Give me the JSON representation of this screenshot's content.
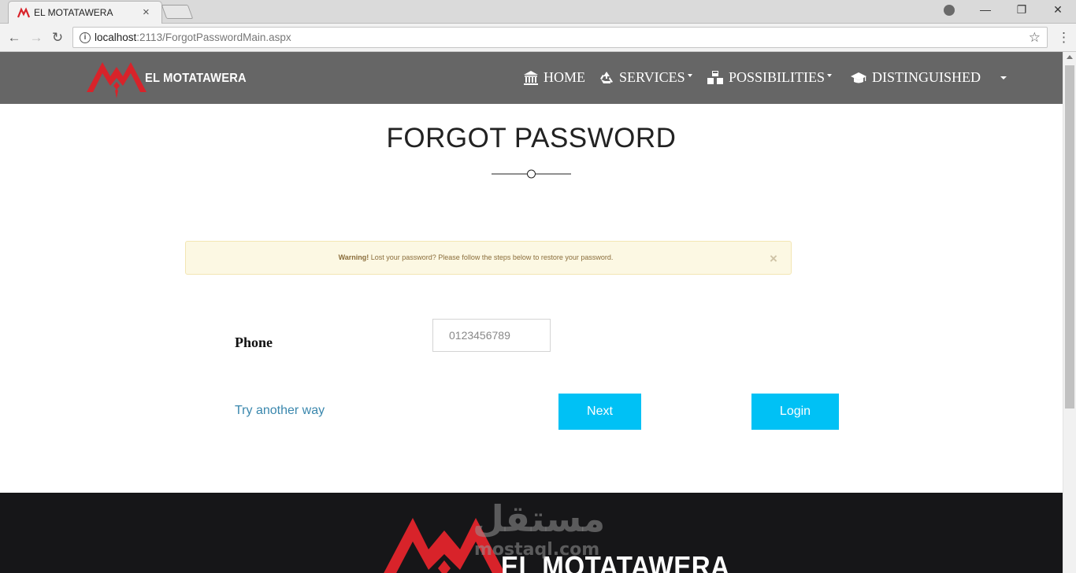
{
  "browser": {
    "tab_title": "EL MOTATAWERA",
    "tab_close": "×",
    "url_host": "localhost",
    "url_path": ":2113/ForgotPasswordMain.aspx",
    "minimize": "—",
    "restore": "❐",
    "close": "✕",
    "back": "←",
    "forward": "→",
    "reload": "↻",
    "star": "☆",
    "menu": "⋮"
  },
  "navbar": {
    "brand": "EL MOTATAWERA",
    "items": [
      {
        "label": "HOME",
        "icon": "bank-icon"
      },
      {
        "label": "SERVICES",
        "icon": "recycle-icon",
        "dropdown": true
      },
      {
        "label": "POSSIBILITIES",
        "icon": "cubes-icon",
        "dropdown": true
      },
      {
        "label": "DISTINGUISHED",
        "icon": "graduation-cap-icon"
      }
    ]
  },
  "main": {
    "title": "FORGOT PASSWORD",
    "alert": {
      "strong": "Warning!",
      "text": " Lost your password? Please follow the steps below to restore your password.",
      "close": "×"
    },
    "phone": {
      "label": "Phone",
      "placeholder": "0123456789",
      "value": ""
    },
    "try_another_way": "Try another way",
    "next_button": "Next",
    "login_button": "Login"
  },
  "footer": {
    "brand": "EL MOTATAWERA",
    "watermark_ar": "مستقل",
    "watermark_en": "mostaql.com"
  },
  "colors": {
    "navbar_bg": "#666666",
    "accent_button": "#00c1f5",
    "logo_red": "#d8232a",
    "alert_bg": "#fcf8e3",
    "footer_bg": "#161618"
  }
}
